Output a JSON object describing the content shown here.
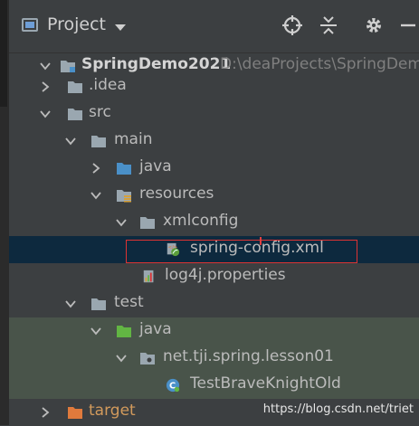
{
  "header": {
    "title": "Project"
  },
  "tree": {
    "root": {
      "label": "SpringDemo2021",
      "path": "D:\\deaProjects\\SpringDem"
    },
    "idea": "idea",
    "idea_prefix": ".",
    "src": "src",
    "main": "main",
    "java": "java",
    "resources": "resources",
    "xmlconfig": "xmlconfig",
    "spring_config": "spring-config.xml",
    "log4j": "log4j.properties",
    "test": "test",
    "test_java": "java",
    "package": "net.tji.spring.lesson01",
    "test_class": "TestBraveKnightOld",
    "target": "target"
  },
  "watermark": "https://blog.csdn.net/triet",
  "colors": {
    "background": "#3c3f41",
    "selection": "#0d293e",
    "test_row": "#49544a",
    "highlight_box": "#dd3333",
    "folder": "#9aa7b0",
    "source_folder": "#4a90c8",
    "test_folder": "#62b543",
    "excluded_folder": "#e07a3c"
  }
}
